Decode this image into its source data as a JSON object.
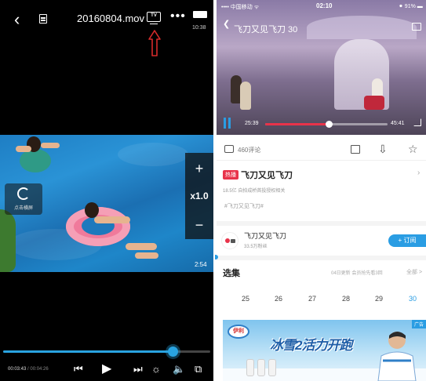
{
  "left_player": {
    "title": "20160804.mov",
    "cast_label": "TV",
    "more_label": "•••",
    "status_time": "10:38",
    "rotate_label": "点击横屏",
    "speed": {
      "plus": "+",
      "value": "x1.0",
      "minus": "−"
    },
    "duration": "2:54",
    "progress_fraction": 0.82,
    "time_current": "00:03:43",
    "time_total": "00:04:26",
    "time_separator": "/",
    "arrow_color": "#d62b2b",
    "accent_color": "#29a3e0"
  },
  "right_app": {
    "status": {
      "carrier": "•••• 中国移动 ᯤ",
      "clock": "02:10",
      "battery": "⚫ 91% ▬"
    },
    "video_title": "飞刀又见飞刀 30",
    "time_current": "25:39",
    "time_total": "45:41",
    "progress_fraction": 0.52,
    "comments_label": "460评论",
    "hot_badge": "热播",
    "show_title": "飞刀又见飞刀",
    "meta_text": "18.5亿   自拍成桥首投授权相关",
    "tag_text": "#飞刀又见飞刀#",
    "channel_name": "飞刀又见飞刀",
    "channel_subs": "33.5万粉丝",
    "subscribe_label": "+ 订阅",
    "episodes_title": "选集",
    "episodes_note": "04日更新 会员抢先看3回",
    "episodes_all": "全部 >",
    "episodes": [
      "25",
      "26",
      "27",
      "28",
      "29",
      "30"
    ],
    "active_episode": "30",
    "ad_tag": "广告",
    "ad_logo": "伊利",
    "ad_slogan": "冰雪2活力开跑",
    "accent_color": "#2a9de3",
    "progress_color": "#e8334a"
  }
}
